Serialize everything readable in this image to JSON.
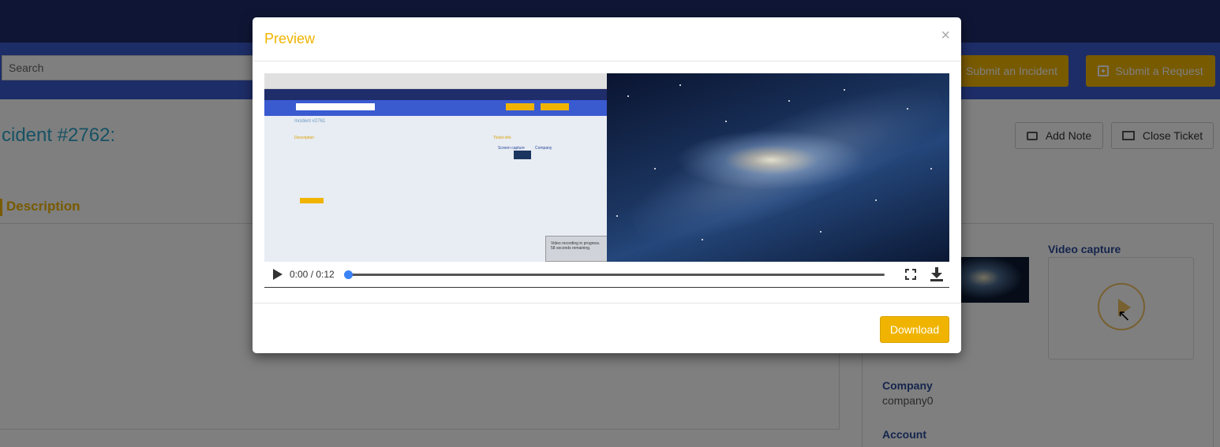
{
  "background": {
    "search": {
      "placeholder": "Search"
    },
    "header_buttons": {
      "incident": "Submit an Incident",
      "request": "Submit a Request"
    },
    "incident_title": "cident #2762:",
    "actions": {
      "add_note": "Add Note",
      "close_ticket": "Close Ticket"
    },
    "description_heading": "Description",
    "info": {
      "video_capture_label": "Video capture",
      "company_label": "Company",
      "company_value": "company0",
      "account_label": "Account"
    }
  },
  "modal": {
    "title": "Preview",
    "close": "×",
    "download_label": "Download",
    "video": {
      "time": "0:00 / 0:12",
      "progress": 0,
      "frame_texts": {
        "incident": "Incident #2761",
        "description": "Description",
        "ticket_info": "Ticket info",
        "screen_capture": "Screen capture",
        "company": "Company",
        "toast": "Video recording in progress. 58 seconds remaining."
      }
    }
  },
  "colors": {
    "accent": "#f0b400",
    "navy": "#1f2d6b",
    "nav_blue": "#3a5ad0",
    "title_teal": "#2ea4c8"
  }
}
